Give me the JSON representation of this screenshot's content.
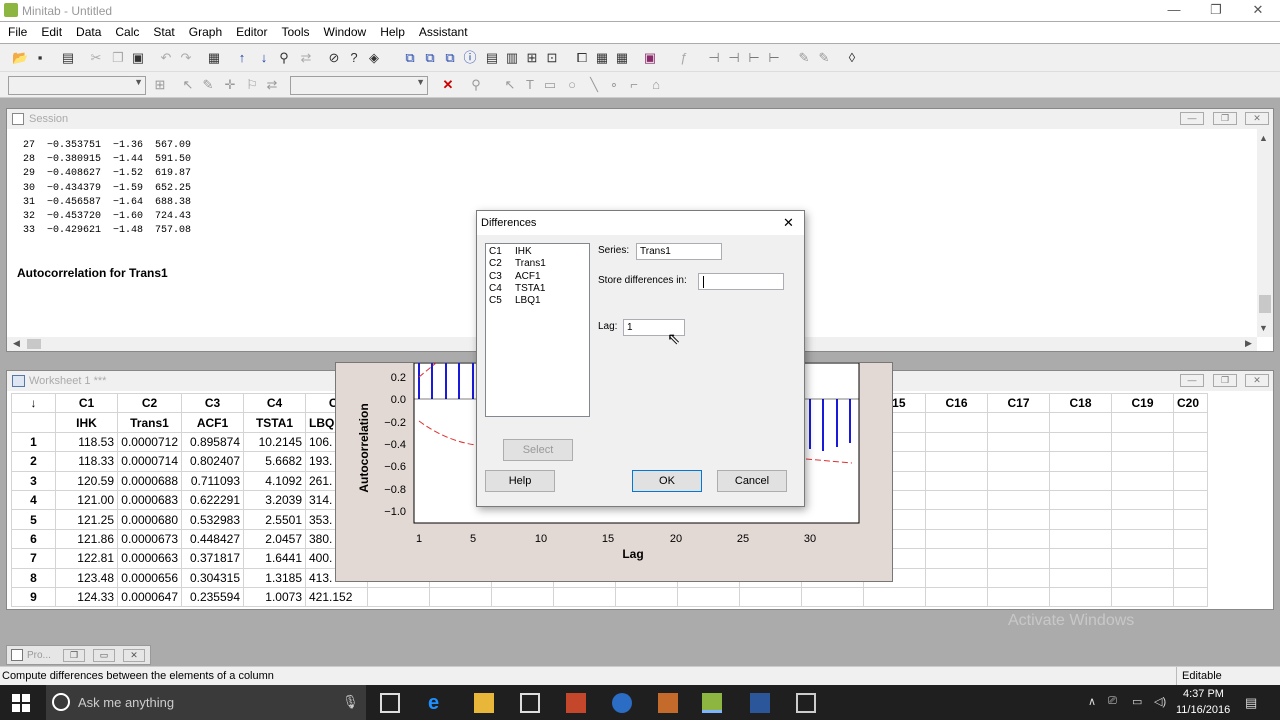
{
  "window": {
    "title": "Minitab - Untitled",
    "minimize": "—",
    "maximize": "❐",
    "close": "✕"
  },
  "menu": [
    "File",
    "Edit",
    "Data",
    "Calc",
    "Stat",
    "Graph",
    "Editor",
    "Tools",
    "Window",
    "Help",
    "Assistant"
  ],
  "session": {
    "title": "Session",
    "rows": [
      "27  −0.353751  −1.36  567.09",
      "28  −0.380915  −1.44  591.50",
      "29  −0.408627  −1.52  619.87",
      "30  −0.434379  −1.59  652.25",
      "31  −0.456587  −1.64  688.38",
      "32  −0.453720  −1.60  724.43",
      "33  −0.429621  −1.48  757.08"
    ],
    "heading": "Autocorrelation for Trans1"
  },
  "worksheet": {
    "title": "Worksheet 1 ***",
    "corner": "↓",
    "col_ids": [
      "C1",
      "C2",
      "C3",
      "C4",
      "C5"
    ],
    "col_names": [
      "IHK",
      "Trans1",
      "ACF1",
      "TSTA1",
      "LBQ1"
    ],
    "right_cols": [
      "C15",
      "C16",
      "C17",
      "C18",
      "C19",
      "C20"
    ],
    "rows": [
      [
        "1",
        "118.53",
        "0.0000712",
        "0.895874",
        "10.2145",
        "106."
      ],
      [
        "2",
        "118.33",
        "0.0000714",
        "0.802407",
        "5.6682",
        "193."
      ],
      [
        "3",
        "120.59",
        "0.0000688",
        "0.711093",
        "4.1092",
        "261."
      ],
      [
        "4",
        "121.00",
        "0.0000683",
        "0.622291",
        "3.2039",
        "314."
      ],
      [
        "5",
        "121.25",
        "0.0000680",
        "0.532983",
        "2.5501",
        "353."
      ],
      [
        "6",
        "121.86",
        "0.0000673",
        "0.448427",
        "2.0457",
        "380."
      ],
      [
        "7",
        "122.81",
        "0.0000663",
        "0.371817",
        "1.6441",
        "400."
      ],
      [
        "8",
        "123.48",
        "0.0000656",
        "0.304315",
        "1.3185",
        "413."
      ],
      [
        "9",
        "124.33",
        "0.0000647",
        "0.235594",
        "1.0073",
        "421.152"
      ]
    ]
  },
  "graph": {
    "ylabel": "Autocorrelation",
    "xlabel": "Lag",
    "yticks": [
      "0.2",
      "0.0",
      "−0.2",
      "−0.4",
      "−0.6",
      "−0.8",
      "−1.0"
    ],
    "xticks": [
      "1",
      "5",
      "10",
      "15",
      "20",
      "25",
      "30"
    ]
  },
  "dialog": {
    "title": "Differences",
    "close": "✕",
    "columns": [
      {
        "id": "C1",
        "name": "IHK"
      },
      {
        "id": "C2",
        "name": "Trans1"
      },
      {
        "id": "C3",
        "name": "ACF1"
      },
      {
        "id": "C4",
        "name": "TSTA1"
      },
      {
        "id": "C5",
        "name": "LBQ1"
      }
    ],
    "series_label": "Series:",
    "series_value": "Trans1",
    "store_label": "Store differences in:",
    "store_value": "",
    "lag_label": "Lag:",
    "lag_value": "1",
    "select_label": "Select",
    "help_label": "Help",
    "ok_label": "OK",
    "cancel_label": "Cancel"
  },
  "project": {
    "title": "Pro..."
  },
  "status": {
    "message": "Compute differences between the elements of a column",
    "mode": "Editable"
  },
  "watermark": "Activate Windows",
  "taskbar": {
    "search_placeholder": "Ask me anything",
    "time": "4:37 PM",
    "date": "11/16/2016"
  }
}
